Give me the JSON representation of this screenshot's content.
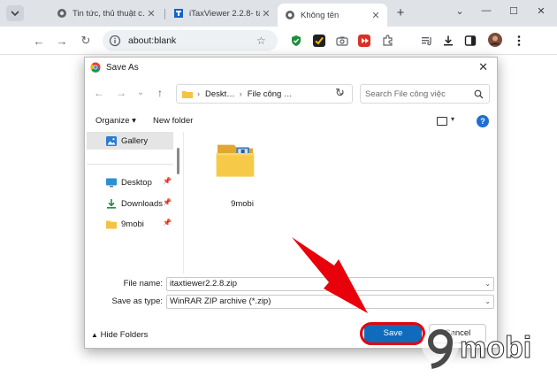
{
  "browser": {
    "tabs": [
      {
        "title": "Tin tức, thủ thuật c…",
        "active": false
      },
      {
        "title": "iTaxViewer 2.2.8- tả…",
        "active": false
      },
      {
        "title": "Không tên",
        "active": true
      }
    ],
    "new_tab_label": "+",
    "window_controls": {
      "chevron": "⌄",
      "minimize": "—",
      "maximize": "☐",
      "close": "✕"
    },
    "address": "about:blank",
    "star": "☆",
    "icons": [
      "back-icon",
      "forward-icon",
      "reload-icon",
      "info-icon",
      "star-icon",
      "shield-extension-icon",
      "checkmark-extension-icon",
      "camera-extension-icon",
      "record-extension-icon",
      "puzzle-icon",
      "media-icon",
      "download-icon",
      "sidepanel-icon",
      "avatar",
      "menu-icon"
    ]
  },
  "dialog": {
    "title": "Save As",
    "close": "✕",
    "path": [
      "Deskt…",
      "File công …"
    ],
    "search_placeholder": "Search File công việc",
    "organize_label": "Organize ▾",
    "new_folder_label": "New folder",
    "help_label": "?",
    "sidebar": [
      {
        "label": "Gallery",
        "icon": "gallery-icon",
        "selected": true,
        "pinned": false
      },
      {
        "label": "Desktop",
        "icon": "desktop-icon",
        "selected": false,
        "pinned": true
      },
      {
        "label": "Downloads",
        "icon": "download-icon",
        "selected": false,
        "pinned": true
      },
      {
        "label": "9mobi",
        "icon": "folder-icon",
        "selected": false,
        "pinned": true
      }
    ],
    "pin_glyph": "📌",
    "folders": [
      {
        "name": "9mobi",
        "icon": "folder-with-archive-icon"
      }
    ],
    "file_name_label": "File name:",
    "file_name_value": "itaxtiewer2.2.8.zip",
    "save_as_type_label": "Save as type:",
    "save_as_type_value": "WinRAR ZIP archive (*.zip)",
    "hide_folders_label": "Hide Folders",
    "save_label": "Save",
    "cancel_label": "Cancel"
  },
  "annotation": {
    "arrow_color": "#e8000b",
    "ring_color": "#e8000b"
  },
  "watermark": {
    "text": "mobi",
    "numeral": "9"
  },
  "colors": {
    "accent": "#0f6cbd",
    "tabstrip": "#dfe3e8",
    "folder": "#f5c342"
  }
}
